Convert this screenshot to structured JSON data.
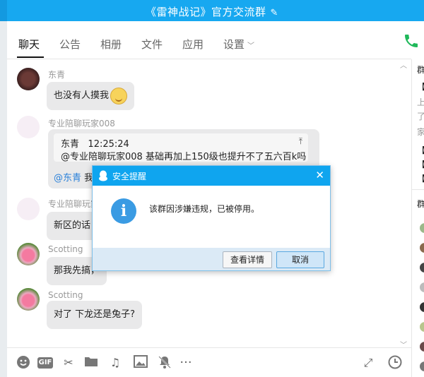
{
  "window": {
    "title": "《雷神战记》官方交流群"
  },
  "tabs": [
    {
      "label": "聊天"
    },
    {
      "label": "公告"
    },
    {
      "label": "相册"
    },
    {
      "label": "文件"
    },
    {
      "label": "应用"
    },
    {
      "label": "设置"
    }
  ],
  "messages": {
    "m1": {
      "sender": "东青",
      "text": "也没有人摸我"
    },
    "m2": {
      "sender": "专业陪聊玩家008",
      "quote_author": "东青",
      "quote_time": "12:25:24",
      "quote_text": "@专业陪聊玩家008 基础再加上150级也提升不了五六百k吗",
      "mention": "@东青",
      "reply_prefix": "我"
    },
    "m3": {
      "sender": "专业陪聊玩家",
      "text": "新区的话"
    },
    "m4": {
      "sender": "Scotting",
      "text": "那我先搞，"
    },
    "m5": {
      "sender": "Scotting",
      "text": "对了 下龙还是兔子?"
    }
  },
  "right_panel": {
    "title": "群",
    "lines": [
      "【",
      "上",
      "了",
      "家",
      "【",
      "【",
      "【"
    ],
    "members_title": "群"
  },
  "dialog": {
    "title": "安全提醒",
    "message": "该群因涉嫌违规，已被停用。",
    "detail_button": "查看详情",
    "cancel_button": "取消"
  },
  "toolbar": {
    "gif_label": "GIF",
    "more_label": "···"
  },
  "colors": {
    "titlebar": "#17a8f0",
    "dialog_header": "#0fa5ef",
    "bubble": "#e9e9ea",
    "mention": "#2980d9",
    "phone": "#1fb85a"
  }
}
